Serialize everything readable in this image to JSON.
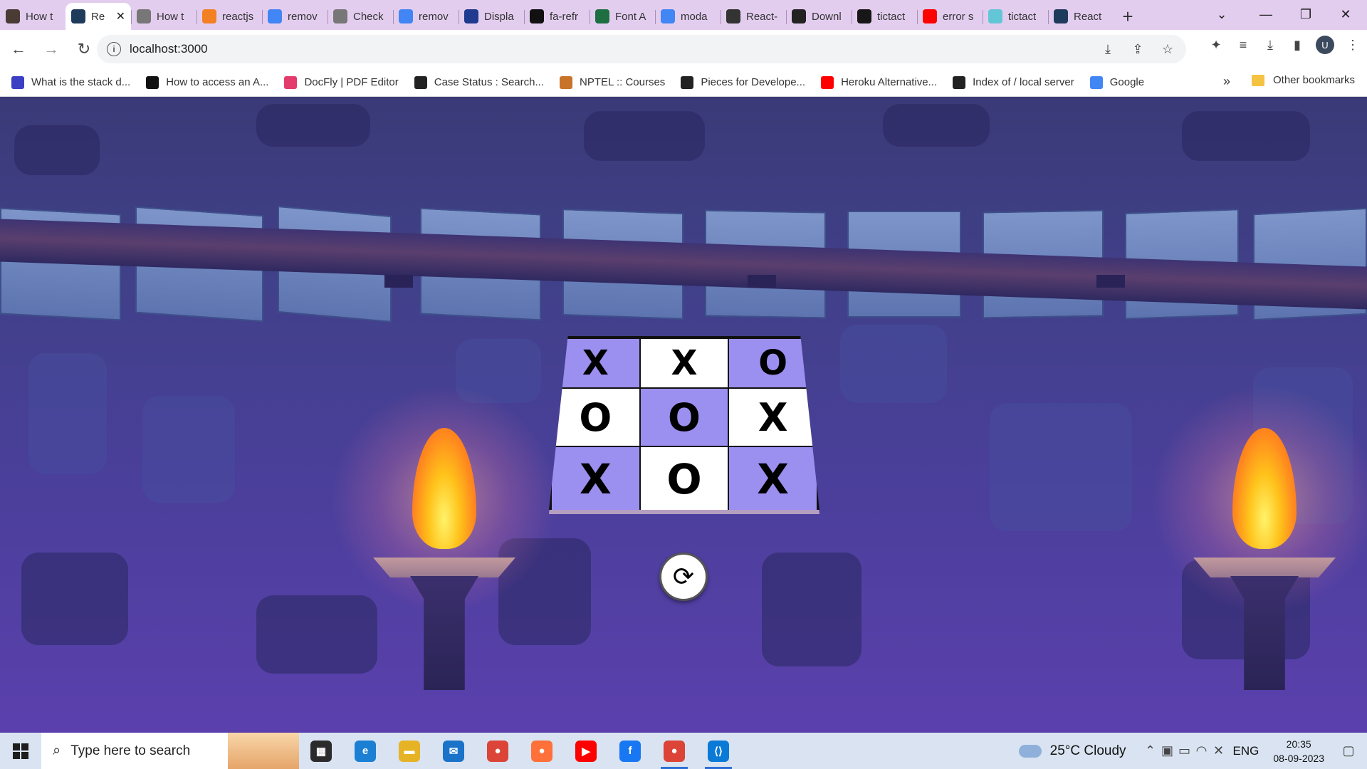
{
  "browser": {
    "tabs": [
      {
        "title": "How t",
        "icon": "person-icon",
        "color": "#4a3b35"
      },
      {
        "title": "Re",
        "icon": "react-icon",
        "color": "#1f3b5c",
        "active": true
      },
      {
        "title": "How t",
        "icon": "codepen-icon",
        "color": "#777777"
      },
      {
        "title": "reactjs",
        "icon": "stackoverflow-icon",
        "color": "#f48024"
      },
      {
        "title": "remov",
        "icon": "google-icon",
        "color": "#4285f4"
      },
      {
        "title": "Check",
        "icon": "codepen-icon",
        "color": "#777777"
      },
      {
        "title": "remov",
        "icon": "google-icon",
        "color": "#4285f4"
      },
      {
        "title": "Displa",
        "icon": "codesandbox-icon",
        "color": "#1f3a8f"
      },
      {
        "title": "fa-refr",
        "icon": "flag-icon",
        "color": "#111111"
      },
      {
        "title": "Font A",
        "icon": "w-icon",
        "color": "#1d6f42"
      },
      {
        "title": "moda",
        "icon": "google-icon",
        "color": "#4285f4"
      },
      {
        "title": "React-",
        "icon": "square-icon",
        "color": "#333333"
      },
      {
        "title": "Downl",
        "icon": "medium-icon",
        "color": "#222222"
      },
      {
        "title": "tictact",
        "icon": "github-icon",
        "color": "#181717"
      },
      {
        "title": "error s",
        "icon": "youtube-icon",
        "color": "#ff0000"
      },
      {
        "title": "tictact",
        "icon": "page-icon",
        "color": "#63c6d6"
      },
      {
        "title": "React",
        "icon": "react-icon",
        "color": "#1f3b5c"
      }
    ],
    "close_tab": "✕",
    "new_tab": "+",
    "url": "localhost:3000",
    "avatar_letter": "U",
    "bookmarks": [
      {
        "label": "What is the stack d...",
        "icon": "terminal-icon",
        "color": "#3b3fc4"
      },
      {
        "label": "How to access an A...",
        "icon": "medium-icon",
        "color": "#111111"
      },
      {
        "label": "DocFly | PDF Editor",
        "icon": "docfly-icon",
        "color": "#e33b6b"
      },
      {
        "label": "Case Status : Search...",
        "icon": "globe-icon",
        "color": "#222222"
      },
      {
        "label": "NPTEL :: Courses",
        "icon": "nptel-icon",
        "color": "#c8732a"
      },
      {
        "label": "Pieces for Develope...",
        "icon": "pieces-icon",
        "color": "#222222"
      },
      {
        "label": "Heroku Alternative...",
        "icon": "youtube-icon",
        "color": "#ff0000"
      },
      {
        "label": "Index of / local server",
        "icon": "globe-icon",
        "color": "#222222"
      },
      {
        "label": "Google",
        "icon": "google-icon",
        "color": "#4285f4"
      }
    ],
    "more_bookmarks": "»",
    "other_bookmarks": "Other bookmarks"
  },
  "game": {
    "board": [
      [
        "X",
        "X",
        "O"
      ],
      [
        "O",
        "O",
        "X"
      ],
      [
        "X",
        "O",
        "X"
      ]
    ],
    "cell_colors": [
      [
        "purple",
        "white",
        "purple"
      ],
      [
        "white",
        "purple",
        "white"
      ],
      [
        "purple",
        "white",
        "purple"
      ]
    ],
    "accent_purple": "#9b8ff0",
    "reset_icon": "refresh-icon",
    "reset_glyph": "⟳"
  },
  "taskbar": {
    "search_placeholder": "Type here to search",
    "apps": [
      {
        "name": "task-view",
        "color": "#2b2b2b",
        "glyph": "▦"
      },
      {
        "name": "edge",
        "color": "#1b7fd4",
        "glyph": "e"
      },
      {
        "name": "file-explorer",
        "color": "#e6b325",
        "glyph": "▬"
      },
      {
        "name": "mail",
        "color": "#1a73c9",
        "glyph": "✉"
      },
      {
        "name": "chrome",
        "color": "#db4437",
        "glyph": "●"
      },
      {
        "name": "firefox",
        "color": "#ff7139",
        "glyph": "●"
      },
      {
        "name": "youtube",
        "color": "#ff0000",
        "glyph": "▶"
      },
      {
        "name": "facebook",
        "color": "#1877f2",
        "glyph": "f"
      },
      {
        "name": "chrome-profile",
        "color": "#db4437",
        "glyph": "●",
        "active": true
      },
      {
        "name": "vscode",
        "color": "#0a7ad6",
        "glyph": "⟨⟩",
        "active": true
      }
    ],
    "weather": "25°C  Cloudy",
    "language": "ENG",
    "time": "20:35",
    "date": "08-09-2023"
  }
}
